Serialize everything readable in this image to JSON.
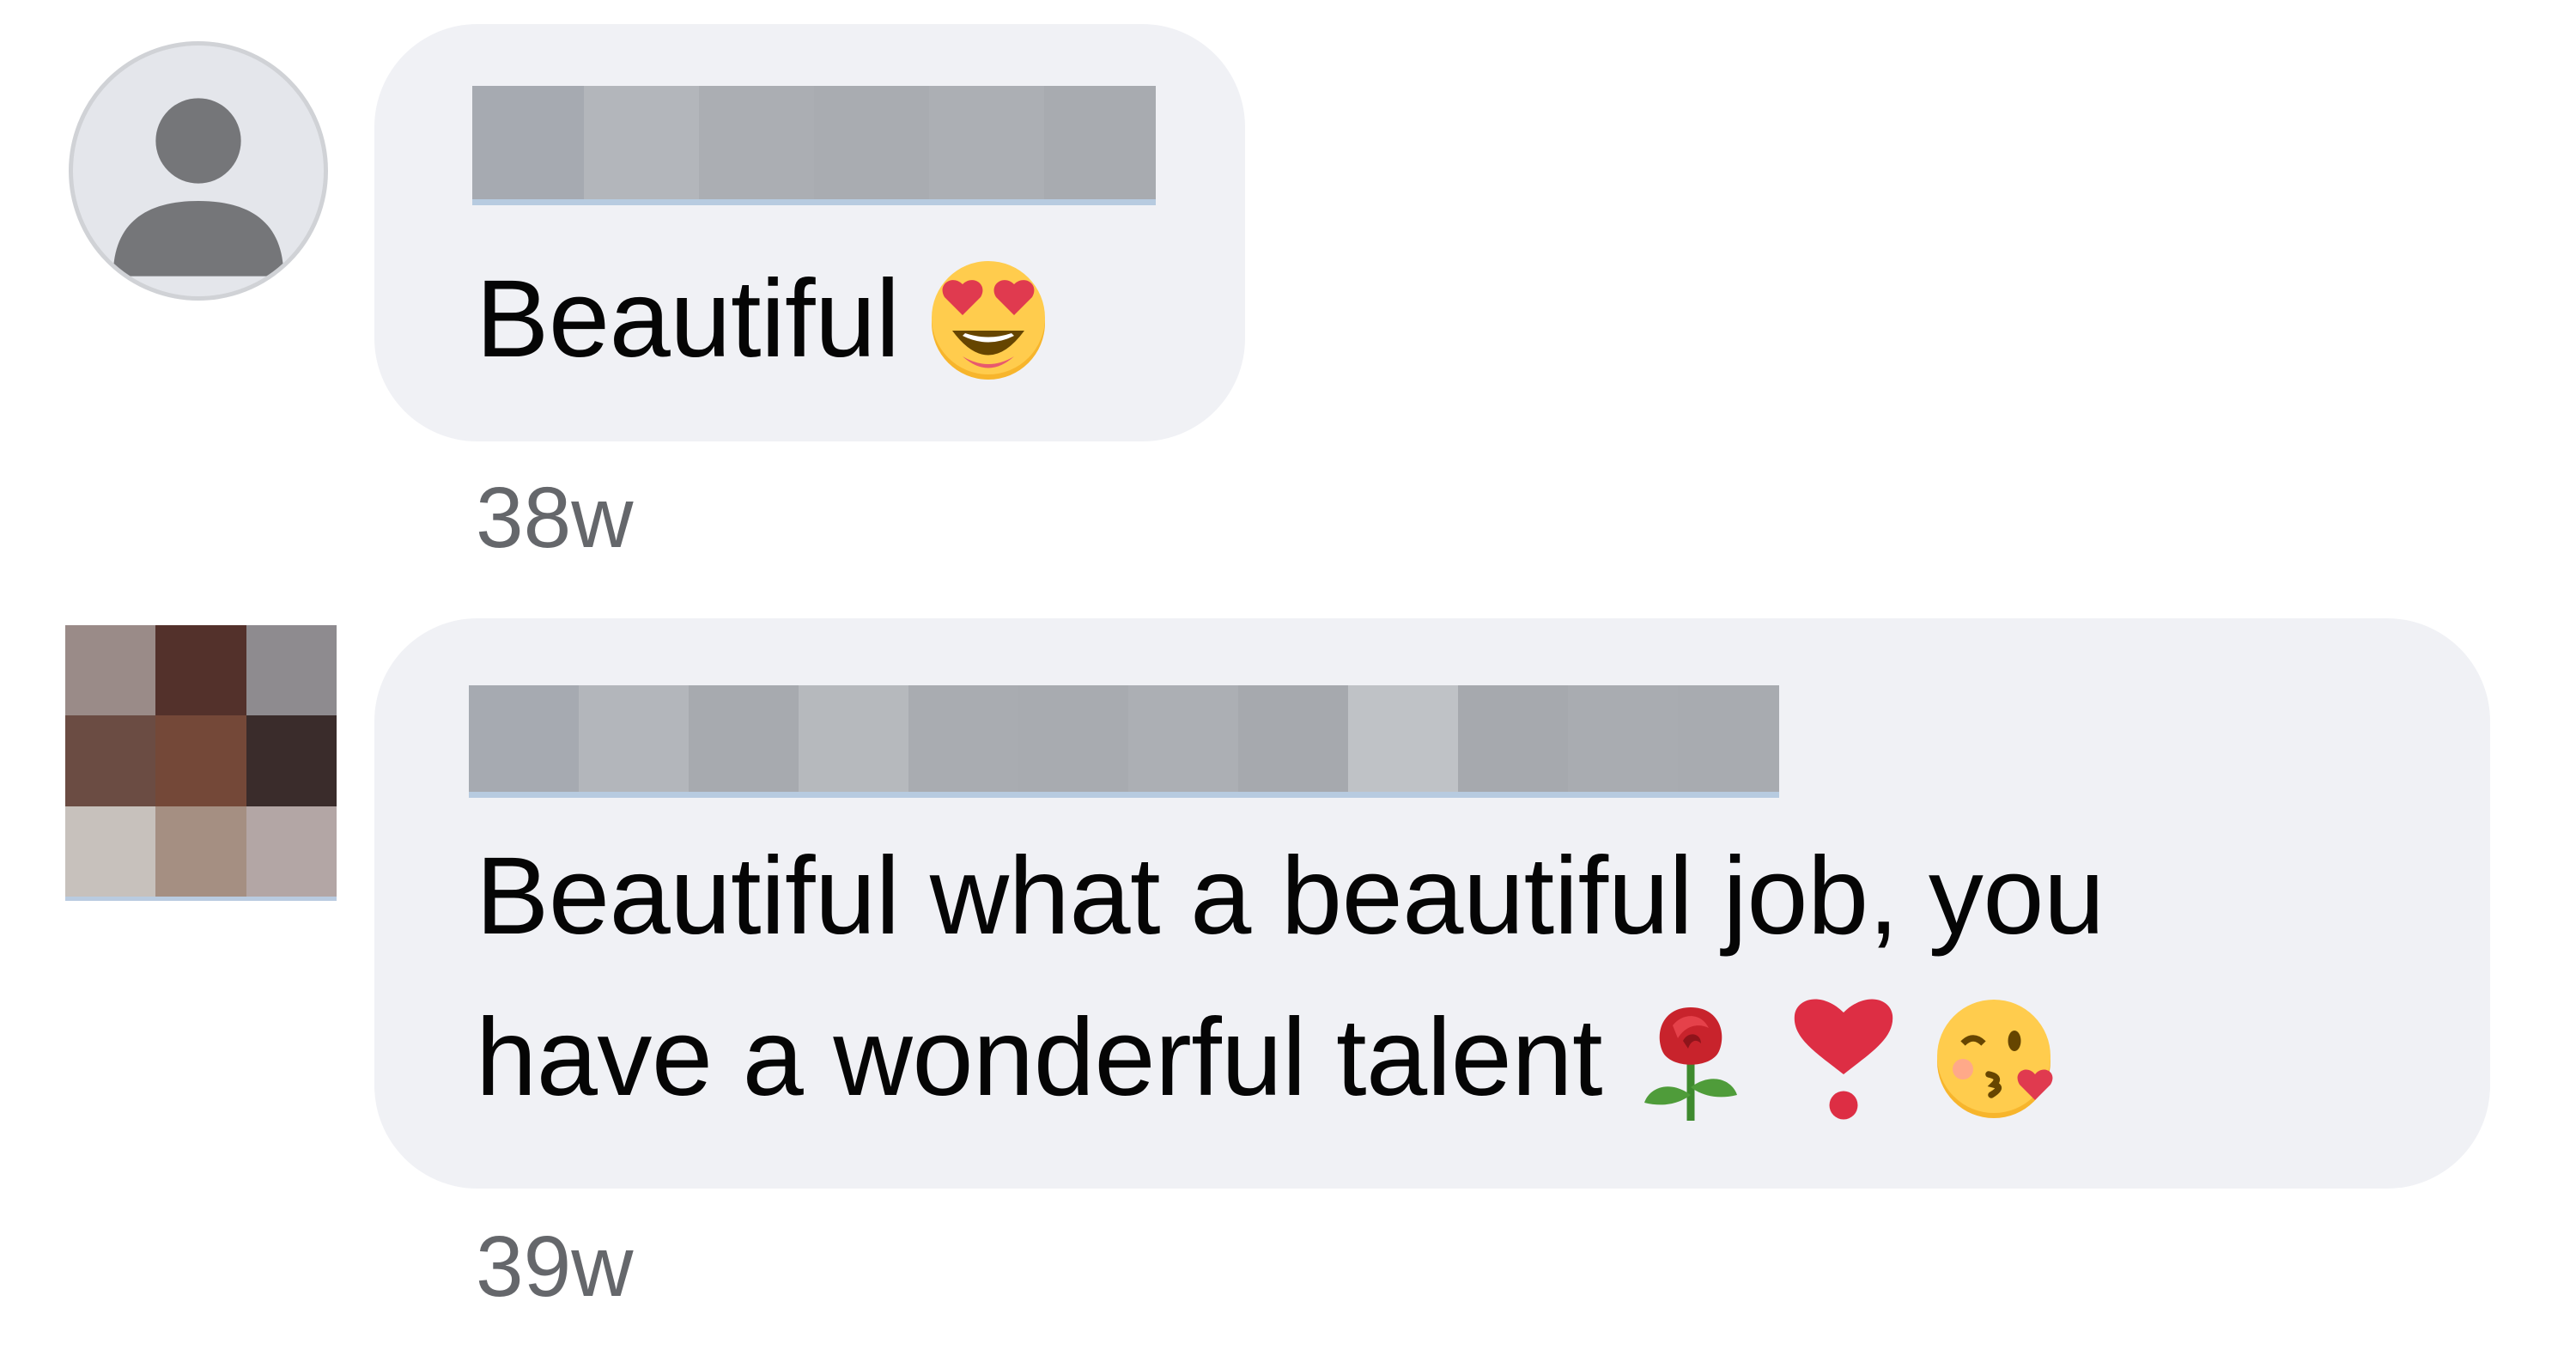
{
  "comments": [
    {
      "author_name_hidden": true,
      "avatar": "default-profile-icon",
      "text": "Beautiful",
      "emojis": [
        "heart-eyes-emoji"
      ],
      "timestamp": "38w"
    },
    {
      "author_name_hidden": true,
      "avatar": "pixelated-photo",
      "text_line_1": "Beautiful what a beautiful job, you",
      "text_line_2": "have a wonderful talent",
      "emojis": [
        "rose-emoji",
        "heart-exclamation-emoji",
        "kissing-wink-emoji"
      ],
      "timestamp": "39w"
    }
  ],
  "colors": {
    "bubble_background": "#f0f1f5",
    "text": "#050505",
    "timestamp": "#65676b",
    "default_avatar_bg": "#e4e6eb",
    "default_avatar_glyph": "#757679"
  }
}
